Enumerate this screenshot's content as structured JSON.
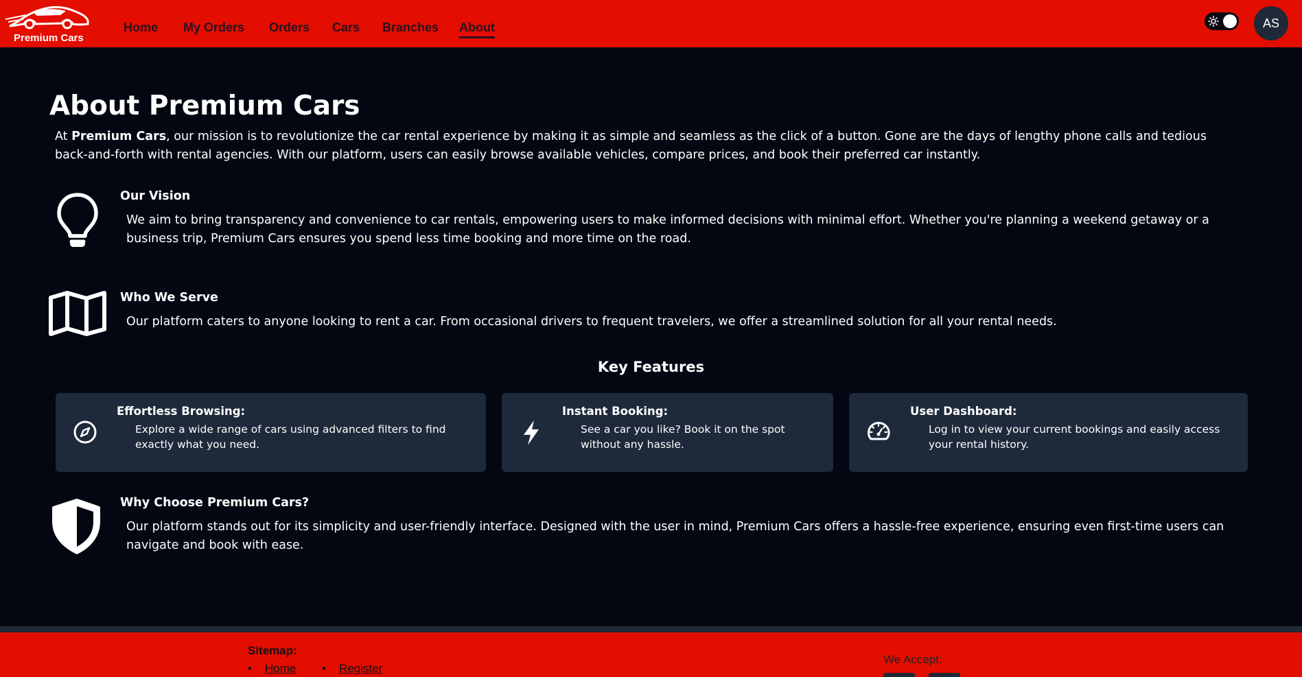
{
  "navbar": {
    "brand": "Premium Cars",
    "links": [
      "Home",
      "My Orders",
      "Orders",
      "Cars",
      "Branches",
      "About"
    ],
    "active": "About",
    "avatar_initials": "AS"
  },
  "about": {
    "title": "About Premium Cars",
    "intro_prefix": "At ",
    "intro_brand": "Premium Cars",
    "intro_rest": ", our mission is to revolutionize the car rental experience by making it as simple and seamless as the click of a button. Gone are the days of lengthy phone calls and tedious back-and-forth with rental agencies. With our platform, users can easily browse available vehicles, compare prices, and book their preferred car instantly."
  },
  "sections": {
    "vision": {
      "heading": "Our Vision",
      "body": "We aim to bring transparency and convenience to car rentals, empowering users to make informed decisions with minimal effort. Whether you're planning a weekend getaway or a business trip, Premium Cars ensures you spend less time booking and more time on the road.",
      "icon": "lightbulb-icon"
    },
    "serve": {
      "heading": "Who We Serve",
      "body": "Our platform caters to anyone looking to rent a car. From occasional drivers to frequent travelers, we offer a streamlined solution for all your rental needs.",
      "icon": "map-icon"
    },
    "why": {
      "heading": "Why Choose Premium Cars?",
      "body": "Our platform stands out for its simplicity and user-friendly interface. Designed with the user in mind, Premium Cars offers a hassle-free experience, ensuring even first-time users can navigate and book with ease.",
      "icon": "shield-icon"
    }
  },
  "features": {
    "title": "Key Features",
    "items": [
      {
        "title": "Effortless Browsing:",
        "body": "Explore a wide range of cars using advanced filters to find exactly what you need.",
        "icon": "compass-icon"
      },
      {
        "title": "Instant Booking:",
        "body": "See a car you like? Book it on the spot without any hassle.",
        "icon": "lightning-icon"
      },
      {
        "title": "User Dashboard:",
        "body": "Log in to view your current bookings and easily access your rental history.",
        "icon": "speedometer-icon"
      }
    ]
  },
  "footer": {
    "sitemap_label": "Sitemap:",
    "links": [
      "Home",
      "Register"
    ],
    "we_accept": "We Accept:"
  },
  "colors": {
    "brand_red": "#e30d00",
    "background": "#030712",
    "card": "#1e293b"
  }
}
